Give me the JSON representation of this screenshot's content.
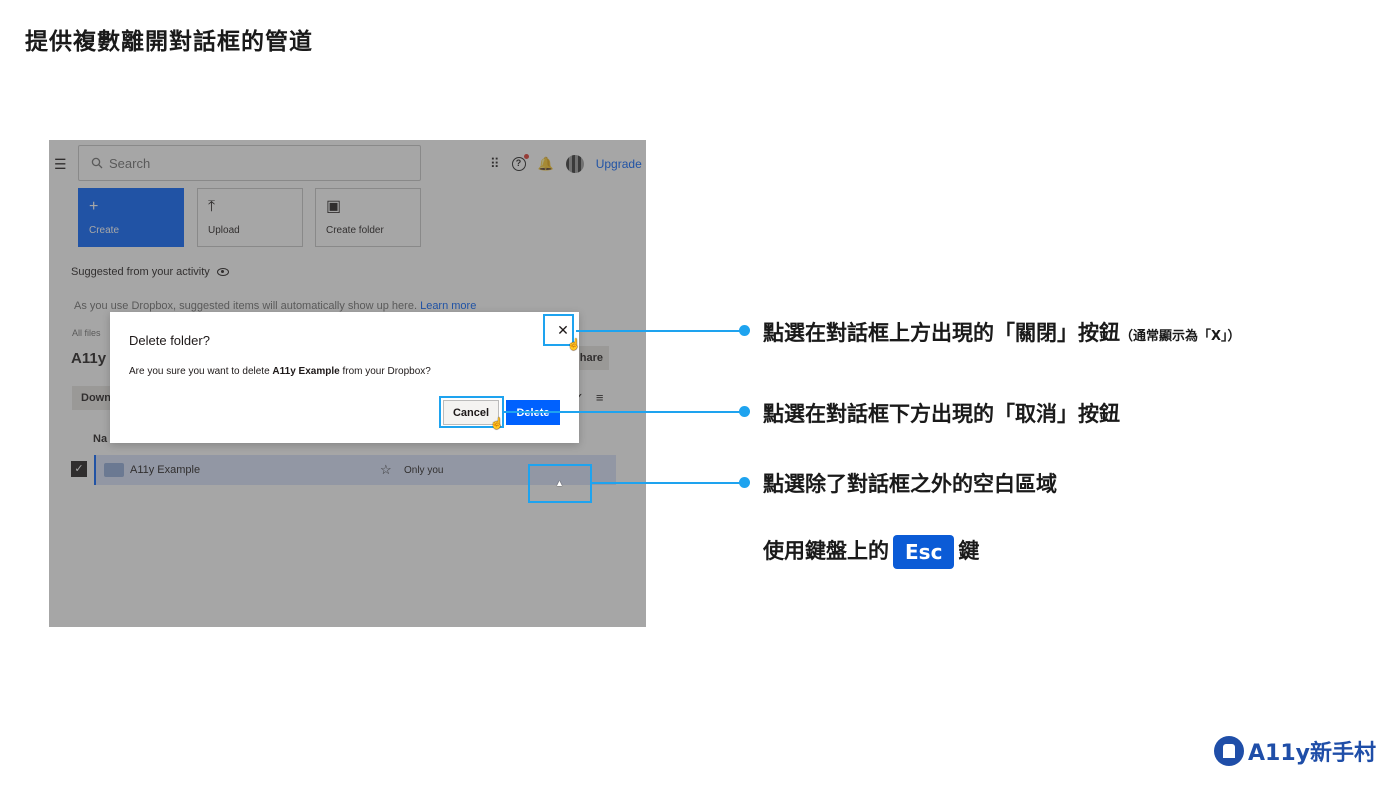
{
  "page": {
    "title": "提供複數離開對話框的管道"
  },
  "screenshot": {
    "search_placeholder": "Search",
    "upgrade": "Upgrade",
    "tiles": [
      {
        "label": "Create",
        "icon": "+"
      },
      {
        "label": "Upload",
        "icon": "⤒"
      },
      {
        "label": "Create folder",
        "icon": "▣"
      }
    ],
    "suggested": "Suggested from your activity",
    "hint": "As you use Dropbox, suggested items will automatically show up here.",
    "learn_more": "Learn more",
    "crumb": "All files",
    "folder_title": "A11y",
    "share": "hare",
    "download": "Down",
    "column_name": "Na",
    "file": {
      "name": "A11y Example",
      "access": "Only you"
    }
  },
  "dialog": {
    "title": "Delete folder?",
    "body_prefix": "Are you sure you want to delete ",
    "body_bold": "A11y Example",
    "body_suffix": " from your Dropbox?",
    "cancel": "Cancel",
    "delete": "Delete",
    "close": "✕"
  },
  "callouts": {
    "close": "點選在對話框上方出現的「關閉」按鈕",
    "close_note": "（通常顯示為「X」）",
    "cancel": "點選在對話框下方出現的「取消」按鈕",
    "outside": "點選除了對話框之外的空白區域",
    "esc_prefix": "使用鍵盤上的",
    "esc_key": "Esc",
    "esc_suffix": "鍵"
  },
  "brand": {
    "name": "A11y新手村"
  },
  "colors": {
    "highlight": "#1ea3ef",
    "dropbox_blue": "#0061fe",
    "esc_key": "#0b5bd6",
    "brand": "#1f4ea8"
  }
}
